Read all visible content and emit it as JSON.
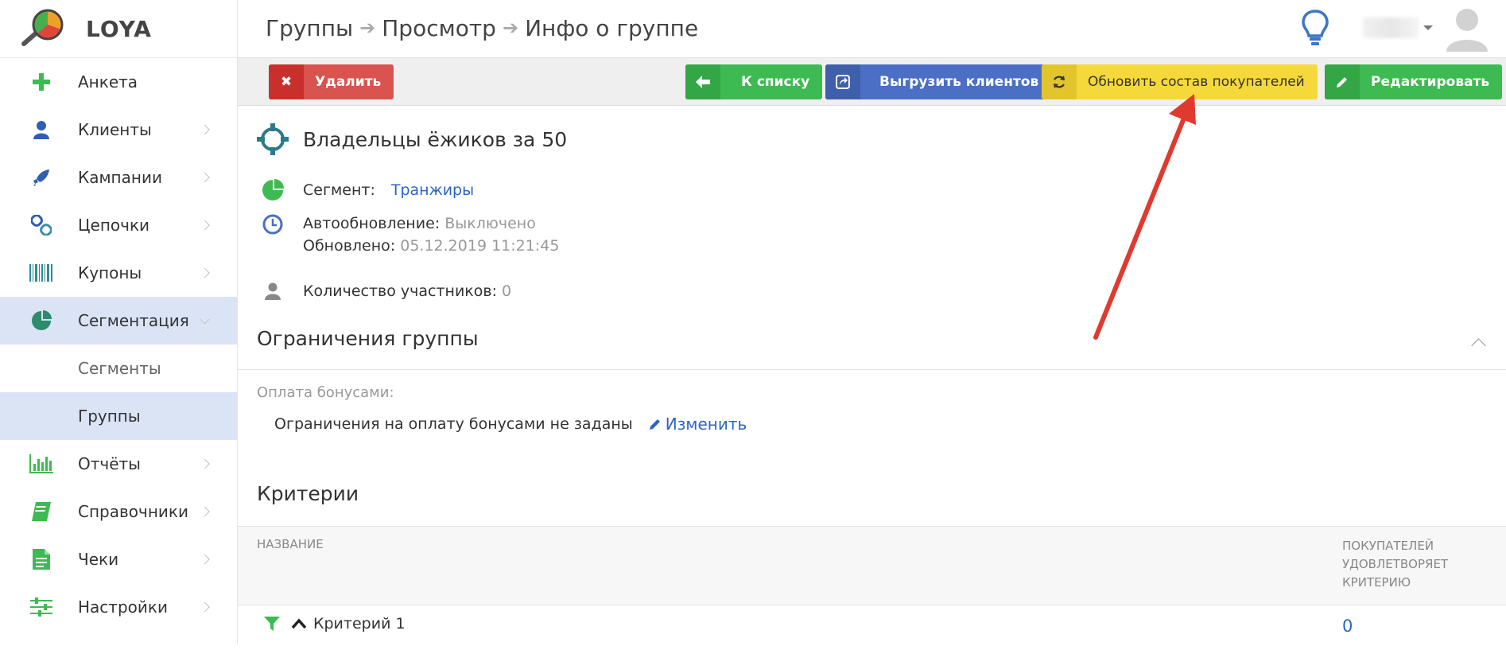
{
  "app": {
    "name": "LOYA"
  },
  "sidebar": {
    "items": [
      {
        "label": "Анкета",
        "icon": "plus-icon"
      },
      {
        "label": "Клиенты",
        "icon": "user-icon"
      },
      {
        "label": "Кампании",
        "icon": "rocket-icon"
      },
      {
        "label": "Цепочки",
        "icon": "chain-icon"
      },
      {
        "label": "Купоны",
        "icon": "barcode-icon"
      },
      {
        "label": "Сегментация",
        "icon": "pie-chart-icon",
        "active": true
      },
      {
        "label": "Отчёты",
        "icon": "bar-chart-icon"
      },
      {
        "label": "Справочники",
        "icon": "book-icon"
      },
      {
        "label": "Чеки",
        "icon": "receipt-icon"
      },
      {
        "label": "Настройки",
        "icon": "sliders-icon"
      }
    ],
    "subitems": [
      {
        "label": "Сегменты"
      },
      {
        "label": "Группы",
        "active": true
      }
    ]
  },
  "header": {
    "breadcrumbs": [
      "Группы",
      "Просмотр",
      "Инфо о группе"
    ]
  },
  "toolbar": {
    "delete": "Удалить",
    "to_list": "К списку",
    "export_clients": "Выгрузить клиентов",
    "refresh_buyers": "Обновить состав покупателей",
    "edit": "Редактировать"
  },
  "group": {
    "title": "Владельцы ёжиков за 50",
    "segment_label": "Сегмент:",
    "segment_value": "Транжиры",
    "autoupdate_label": "Автообновление:",
    "autoupdate_value": "Выключено",
    "updated_label": "Обновлено:",
    "updated_value": "05.12.2019 11:21:45",
    "members_label": "Количество участников:",
    "members_value": "0"
  },
  "limits": {
    "title": "Ограничения группы",
    "pay_label": "Оплата бонусами:",
    "pay_text": "Ограничения на оплату бонусами не заданы",
    "change_link": "Изменить"
  },
  "criteria": {
    "title": "Критерии",
    "col_name": "НАЗВАНИЕ",
    "col_count_lines": [
      "ПОКУПАТЕЛЕЙ",
      "УДОВЛЕТВОРЯЕТ",
      "КРИТЕРИЮ"
    ],
    "rows": [
      {
        "name": "Критерий 1",
        "count": "0"
      }
    ]
  },
  "colors": {
    "green": "#3dbb52",
    "red": "#d9534f",
    "blue": "#4a6fc4",
    "yellow": "#f5d93b",
    "link": "#2a66c2",
    "active_bg": "#dbe4f5",
    "annotation": "#e03a2f"
  }
}
